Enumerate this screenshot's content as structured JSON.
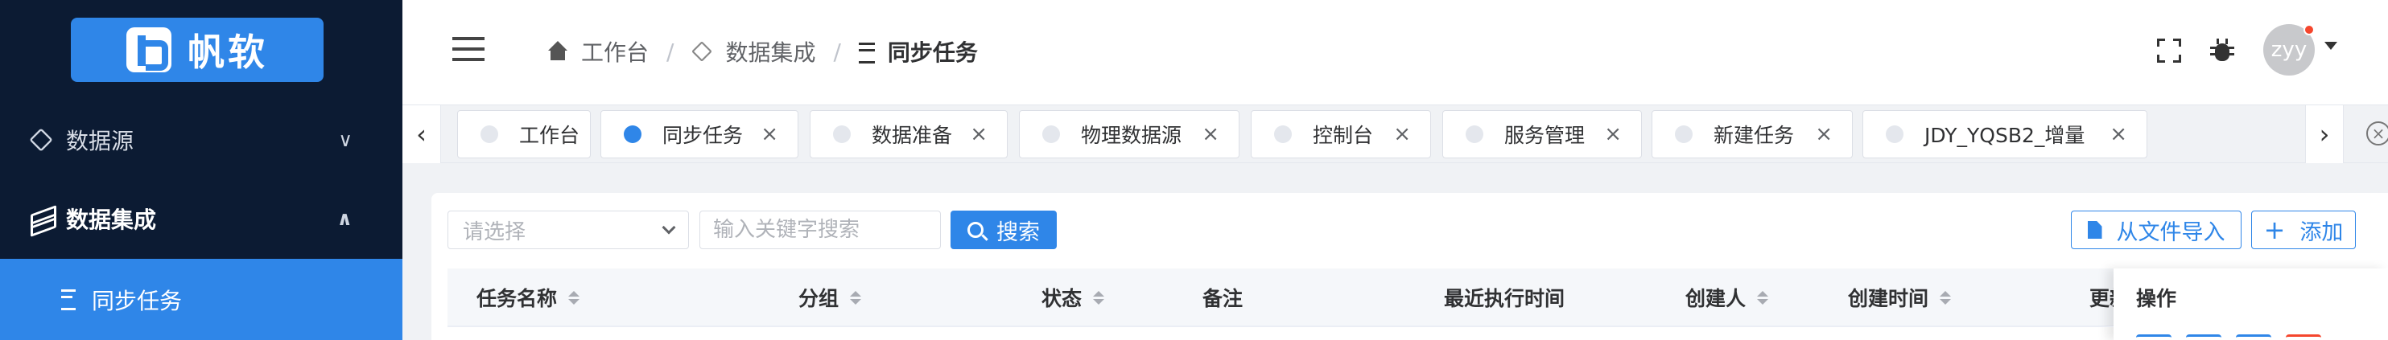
{
  "brand": {
    "name": "帆软"
  },
  "sidebar": {
    "items": [
      {
        "label": "数据源",
        "icon": "cube-icon",
        "arrow": "∨"
      },
      {
        "label": "数据集成",
        "icon": "stack-icon",
        "arrow": "∧"
      },
      {
        "label": "同步任务",
        "icon": "list-icon",
        "active": true
      }
    ]
  },
  "header": {
    "breadcrumb": [
      "工作台",
      "数据集成",
      "同步任务"
    ],
    "user": {
      "avatar_text": "zyy",
      "status_color": "#f5462d"
    }
  },
  "tabs": [
    {
      "label": "工作台",
      "active": false,
      "closable": false
    },
    {
      "label": "同步任务",
      "active": true,
      "closable": true
    },
    {
      "label": "数据准备",
      "active": false,
      "closable": true
    },
    {
      "label": "物理数据源",
      "active": false,
      "closable": true
    },
    {
      "label": "控制台",
      "active": false,
      "closable": true
    },
    {
      "label": "服务管理",
      "active": false,
      "closable": true
    },
    {
      "label": "新建任务",
      "active": false,
      "closable": true
    },
    {
      "label": "JDY_YQSB2_增量",
      "active": false,
      "closable": true
    }
  ],
  "toolbar": {
    "select_placeholder": "请选择",
    "search_placeholder": "输入关键字搜索",
    "search_label": "搜索",
    "import_label": "从文件导入",
    "add_label": "添加"
  },
  "table": {
    "columns": [
      "任务名称",
      "分组",
      "状态",
      "备注",
      "最近执行时间",
      "创建人",
      "创建时间",
      "更新",
      "操作"
    ]
  },
  "colors": {
    "accent": "#2f86e8",
    "sidebar_bg": "#0c1b33",
    "danger": "#f5462d"
  }
}
